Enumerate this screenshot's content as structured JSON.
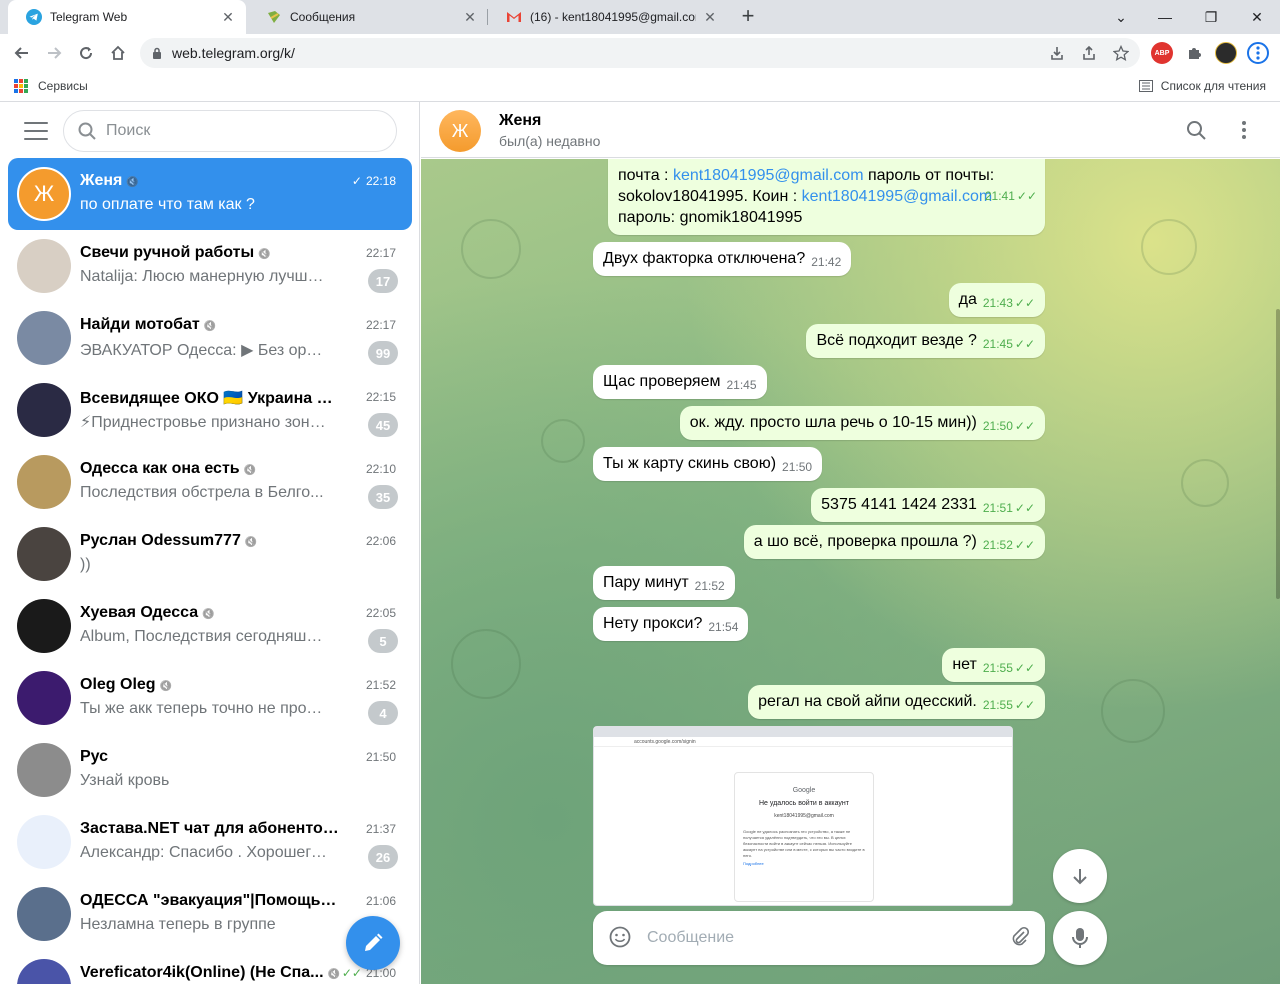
{
  "browser": {
    "tabs": [
      {
        "title": "Telegram Web",
        "icon": "telegram-icon",
        "active": true
      },
      {
        "title": "Сообщения",
        "icon": "messages-icon",
        "active": false
      },
      {
        "title": "(16) - kent18041995@gmail.com",
        "icon": "gmail-icon",
        "active": false
      }
    ],
    "url": "web.telegram.org/k/",
    "bookmarks": {
      "apps_label": "Сервисы",
      "reading_list_label": "Список для чтения"
    },
    "extensions": {
      "abp": "ABP"
    }
  },
  "sidebar": {
    "search_placeholder": "Поиск",
    "chats": [
      {
        "name": "Женя",
        "time": "22:18",
        "preview": "по оплате что там как ?",
        "badge": "",
        "avatar_letter": "Ж",
        "avatar_color": "#f49b2d",
        "muted": true,
        "sent": true,
        "active": true
      },
      {
        "name": "Свечи ручной работы",
        "time": "22:17",
        "preview": "Natalija: Люсю манерную лучше не ...",
        "badge": "17",
        "avatar_letter": "",
        "avatar_color": "#d8cfc4",
        "muted": true
      },
      {
        "name": "Найди мотобат",
        "time": "22:17",
        "preview": "ЭВАКУАТОР Одесса: ▶ Без оружи...",
        "badge": "99",
        "avatar_letter": "",
        "avatar_color": "#7a8aa3",
        "muted": true
      },
      {
        "name": "Всевидящее ОКО 🇺🇦 Украина во...",
        "time": "22:15",
        "preview": "⚡Приднестровье признано зоной ...",
        "badge": "45",
        "avatar_letter": "",
        "avatar_color": "#2a2a44",
        "muted": true
      },
      {
        "name": "Одесса как она есть",
        "time": "22:10",
        "preview": "Последствия обстрела в Белго...",
        "badge": "35",
        "avatar_letter": "",
        "avatar_color": "#b89a5f",
        "muted": true
      },
      {
        "name": "Руслан Odessum777",
        "time": "22:06",
        "preview": "))",
        "badge": "",
        "avatar_letter": "",
        "avatar_color": "#4a4440",
        "muted": true
      },
      {
        "name": "Хуевая Одесса",
        "time": "22:05",
        "preview": "Album, Последствия сегодняшне...",
        "badge": "5",
        "avatar_letter": "",
        "avatar_color": "#1a1a1a",
        "muted": true
      },
      {
        "name": "Oleg Oleg",
        "time": "21:52",
        "preview": "Ты же акк теперь точно не продашь",
        "badge": "4",
        "avatar_letter": "",
        "avatar_color": "#3c1b6e",
        "muted": true
      },
      {
        "name": "Рус",
        "time": "21:50",
        "preview": "Узнай кровь",
        "badge": "",
        "avatar_letter": "",
        "avatar_color": "#8c8c8c",
        "muted": false
      },
      {
        "name": "Застава.NET чат для абонентов",
        "time": "21:37",
        "preview": "Александр: Спасибо . Хорошего ве...",
        "badge": "26",
        "avatar_letter": "",
        "avatar_color": "#e9f0fb",
        "muted": true
      },
      {
        "name": "ОДЕССА \"эвакуация\"|Помощь бе...",
        "time": "21:06",
        "preview": "Незламна теперь в группе",
        "badge": "",
        "avatar_letter": "",
        "avatar_color": "#5a6f8c",
        "muted": true
      },
      {
        "name": "Vereficator4ik(Online) (Не Спа...",
        "time": "21:00",
        "preview": "",
        "badge": "",
        "avatar_letter": "",
        "avatar_color": "#4a54a8",
        "muted": true,
        "sent": true
      }
    ]
  },
  "chat": {
    "name": "Женя",
    "status": "был(а) недавно",
    "avatar_letter": "Ж",
    "messages": [
      {
        "dir": "out",
        "line1_prefix": "почта : ",
        "line1_link": "kent18041995@gmail.com",
        "line1_suffix": " пароль от почты:",
        "line2_prefix": "sokolov18041995. Коин : ",
        "line2_link": "kent18041995@gmail.com",
        "line3": "пароль: gnomik18041995",
        "time": "21:41"
      },
      {
        "dir": "in",
        "text": "Двух факторка отключена?",
        "time": "21:42"
      },
      {
        "dir": "out",
        "text": "да",
        "time": "21:43"
      },
      {
        "dir": "out",
        "text": "Всё подходит везде ?",
        "time": "21:45"
      },
      {
        "dir": "in",
        "text": "Щас проверяем",
        "time": "21:45"
      },
      {
        "dir": "out",
        "text": "ок. жду. просто шла речь о 10-15 мин))",
        "time": "21:50"
      },
      {
        "dir": "in",
        "text": "Ты ж карту скинь свою)",
        "time": "21:50"
      },
      {
        "dir": "out",
        "text": "5375 4141 1424 2331",
        "time": "21:51"
      },
      {
        "dir": "out",
        "text": "а шо всё, проверка прошла ?)",
        "time": "21:52"
      },
      {
        "dir": "in",
        "text": "Пару минут",
        "time": "21:52"
      },
      {
        "dir": "in",
        "text": "Нету прокси?",
        "time": "21:54"
      },
      {
        "dir": "out",
        "text": "нет",
        "time": "21:55"
      },
      {
        "dir": "out",
        "text": "регал на свой айпи одесский.",
        "time": "21:55"
      }
    ],
    "photo": {
      "logo": "Google",
      "title": "Не удалось войти в аккаунт",
      "email": "kent18041995@gmail.com",
      "text": "Google не удалось распознать это устройство, а также не получается удалённо подтвердить, что это вы. В целях безопасности войти в аккаунт сейчас нельзя. Используйте аккаунт на устройстве или в месте, с которых вы часто входите в него.",
      "link": "Подробнее"
    },
    "composer_placeholder": "Сообщение"
  }
}
